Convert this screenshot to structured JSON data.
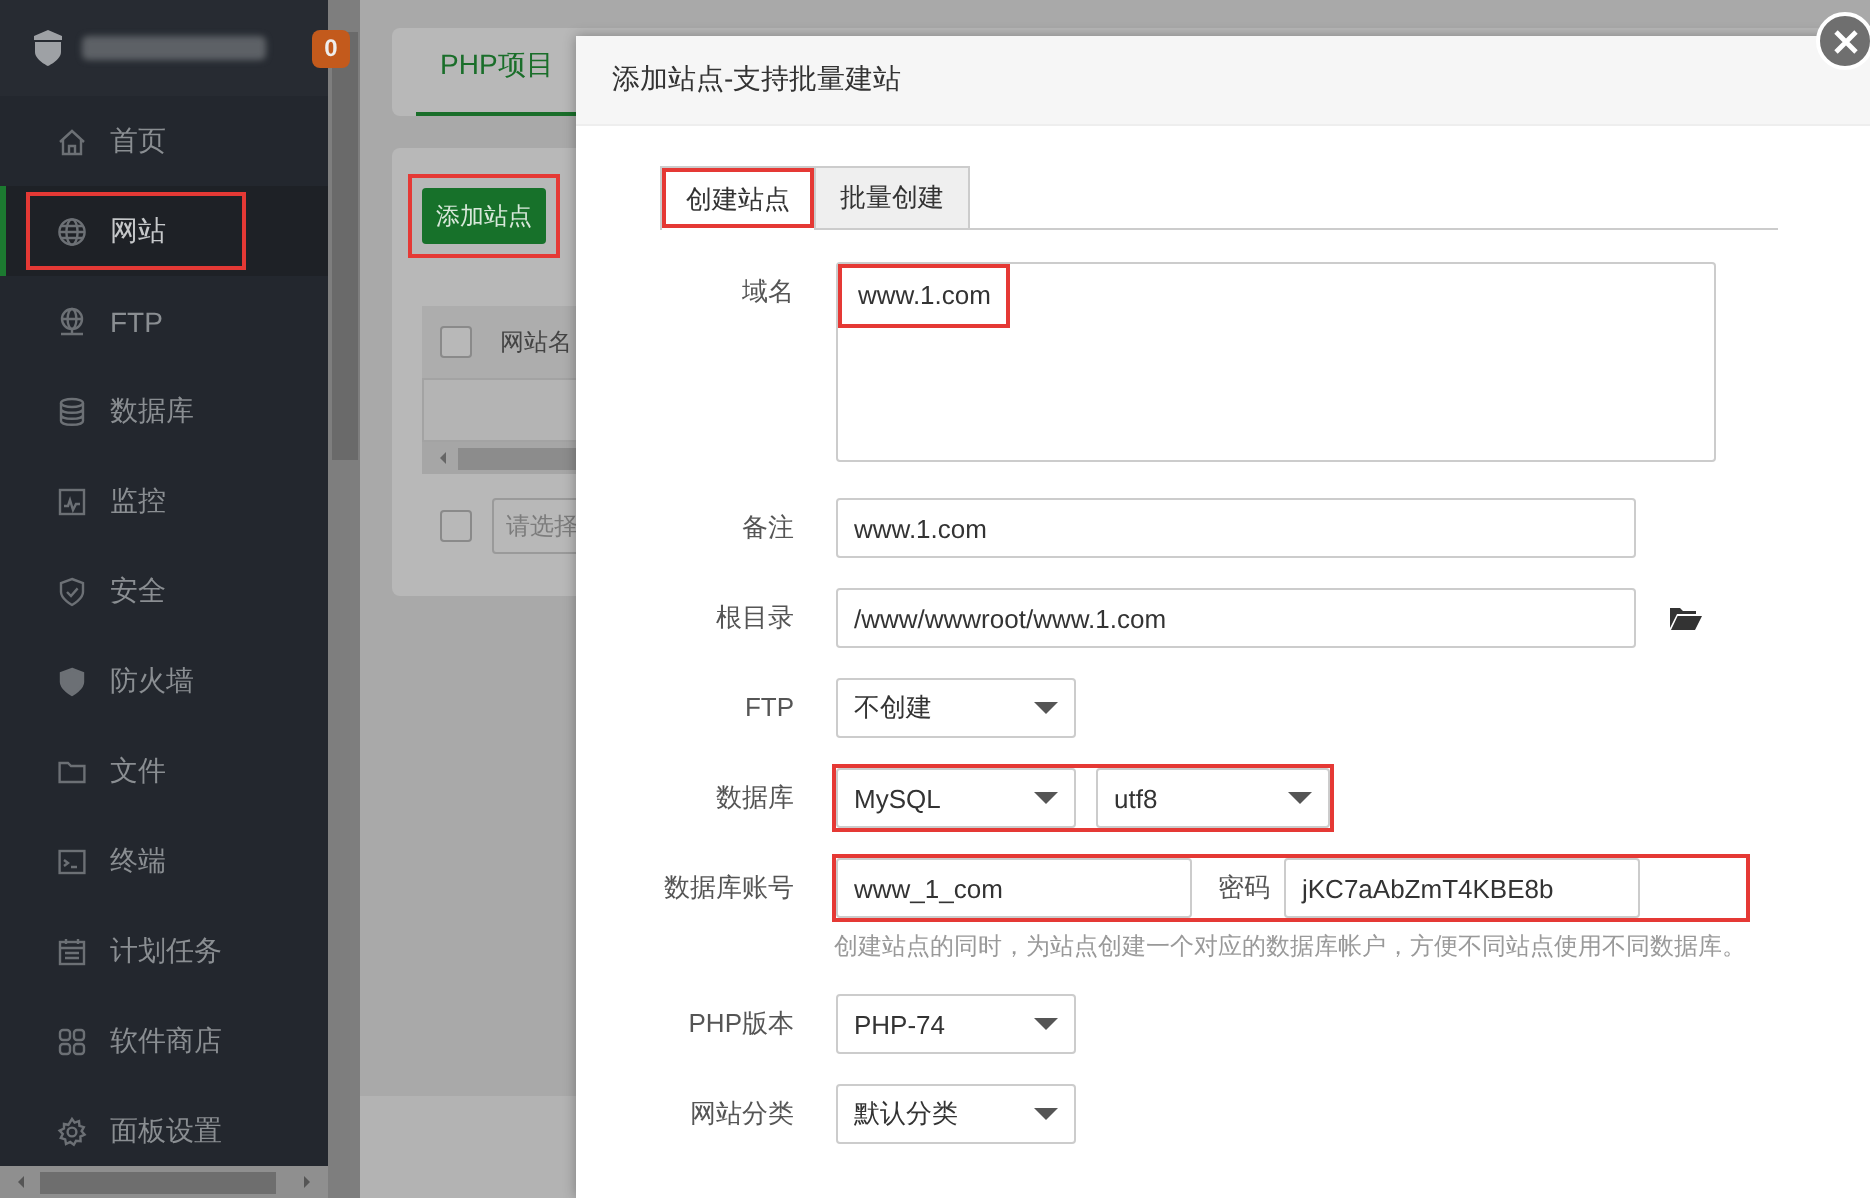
{
  "sidebar": {
    "badge": "0",
    "items": [
      {
        "label": "首页",
        "selected": false,
        "highlighted": false
      },
      {
        "label": "网站",
        "selected": true,
        "highlighted": true
      },
      {
        "label": "FTP",
        "selected": false,
        "highlighted": false
      },
      {
        "label": "数据库",
        "selected": false,
        "highlighted": false
      },
      {
        "label": "监控",
        "selected": false,
        "highlighted": false
      },
      {
        "label": "安全",
        "selected": false,
        "highlighted": false
      },
      {
        "label": "防火墙",
        "selected": false,
        "highlighted": false
      },
      {
        "label": "文件",
        "selected": false,
        "highlighted": false
      },
      {
        "label": "终端",
        "selected": false,
        "highlighted": false
      },
      {
        "label": "计划任务",
        "selected": false,
        "highlighted": false
      },
      {
        "label": "软件商店",
        "selected": false,
        "highlighted": false
      },
      {
        "label": "面板设置",
        "selected": false,
        "highlighted": false
      }
    ]
  },
  "page": {
    "tabs": [
      {
        "label": "PHP项目",
        "selected": true
      }
    ],
    "add_button": {
      "label": "添加站点",
      "highlighted": true
    },
    "table": {
      "columns": [
        "网站名"
      ],
      "select_all_checked": false
    },
    "batch_select": {
      "placeholder": "请选择",
      "checked": false
    }
  },
  "dialog": {
    "title": "添加站点-支持批量建站",
    "tabs": [
      {
        "label": "创建站点",
        "selected": true,
        "highlighted": true
      },
      {
        "label": "批量创建",
        "selected": false,
        "highlighted": false
      }
    ],
    "fields": [
      {
        "kind": "textarea",
        "label": "域名",
        "value": "www.1.com",
        "highlighted": true
      },
      {
        "kind": "input",
        "label": "备注",
        "value": "www.1.com"
      },
      {
        "kind": "path",
        "label": "根目录",
        "value": "/www/wwwroot/www.1.com"
      },
      {
        "kind": "select",
        "label": "FTP",
        "value": "不创建"
      },
      {
        "kind": "select_pair",
        "label": "数据库",
        "values": [
          "MySQL",
          "utf8"
        ],
        "highlighted": true
      },
      {
        "kind": "account",
        "label": "数据库账号",
        "value": "www_1_com",
        "password_label": "密码",
        "password": "jKC7aAbZmT4KBE8b",
        "highlighted": true,
        "hint": "创建站点的同时，为站点创建一个对应的数据库帐户，方便不同站点使用不同数据库。"
      },
      {
        "kind": "select",
        "label": "PHP版本",
        "value": "PHP-74"
      },
      {
        "kind": "select",
        "label": "网站分类",
        "value": "默认分类"
      }
    ]
  }
}
